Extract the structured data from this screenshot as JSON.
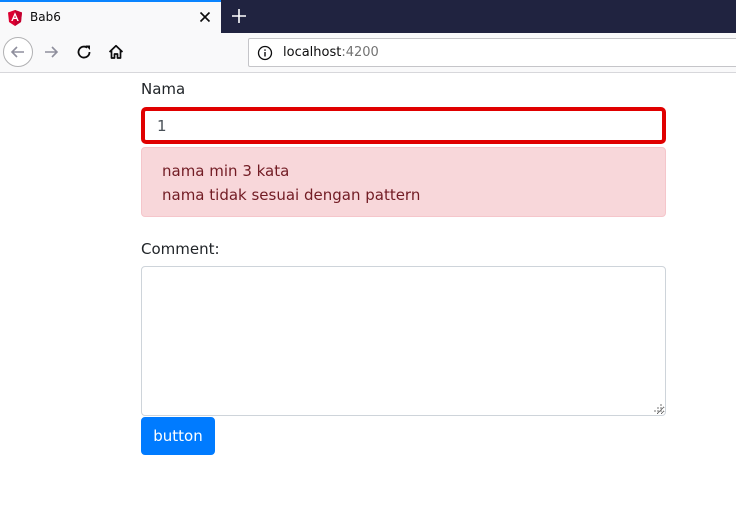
{
  "browser": {
    "tab_title": "Bab6",
    "url_host": "localhost",
    "url_port": ":4200",
    "accent_color": "#0a84ff"
  },
  "form": {
    "name_label": "Nama",
    "name_value": "1",
    "errors": [
      "nama min 3 kata",
      "nama tidak sesuai dengan pattern"
    ],
    "comment_label": "Comment:",
    "comment_value": "",
    "button_label": "button",
    "error_border_color": "#e00000",
    "button_color": "#007bff"
  },
  "icons": {
    "tab_favicon": "angular-icon",
    "tab_close": "close-icon",
    "new_tab": "plus-icon",
    "back": "arrow-left-icon",
    "forward": "arrow-right-icon",
    "reload": "reload-icon",
    "home": "home-icon",
    "site_info": "info-icon",
    "resize": "resize-grip-icon"
  }
}
